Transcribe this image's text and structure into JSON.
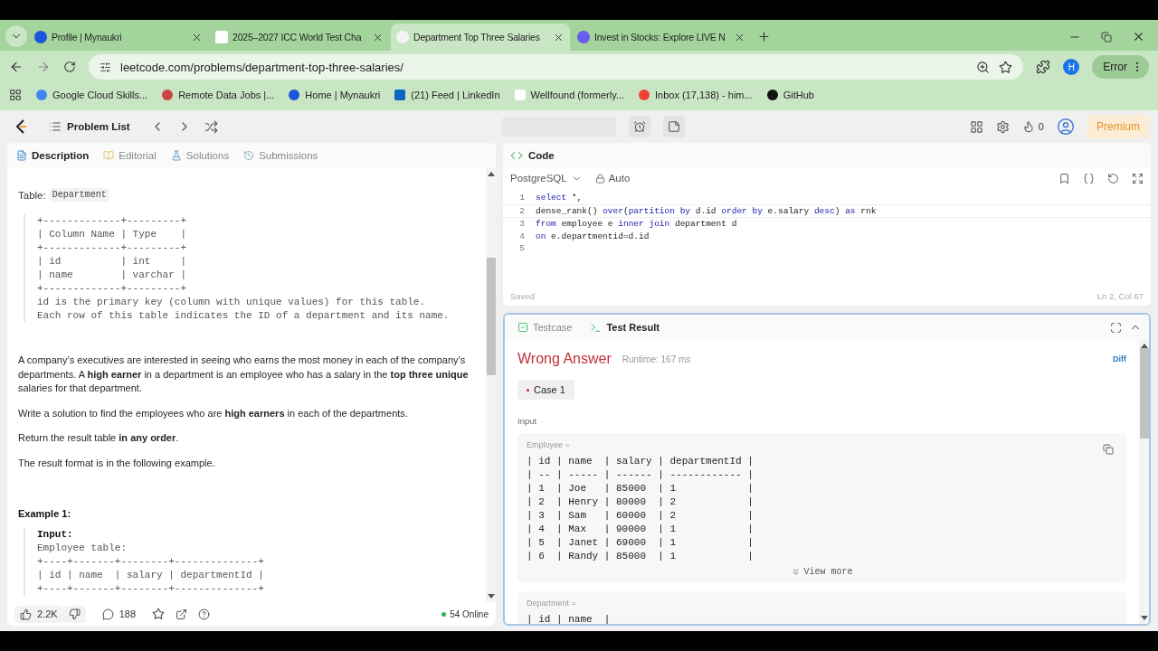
{
  "browser": {
    "tabs": [
      {
        "title": "Profile | Mynaukri",
        "selected": false
      },
      {
        "title": "2025–2027 ICC World Test Cha",
        "selected": false
      },
      {
        "title": "Department Top Three Salaries",
        "selected": true
      },
      {
        "title": "Invest in Stocks: Explore LIVE N",
        "selected": false
      }
    ],
    "address": "leetcode.com/problems/department-top-three-salaries/",
    "profile_initial": "H",
    "error_button": "Error",
    "bookmarks": [
      "Google Cloud Skills...",
      "Remote Data Jobs |...",
      "Home | Mynaukri",
      "(21) Feed | LinkedIn",
      "Wellfound (formerly...",
      "Inbox (17,138) - him...",
      "GitHub"
    ]
  },
  "topbar": {
    "problem_list": "Problem List",
    "streak": "0",
    "premium": "Premium"
  },
  "description": {
    "tabs": [
      {
        "label": "Description",
        "selected": true
      },
      {
        "label": "Editorial",
        "selected": false
      },
      {
        "label": "Solutions",
        "selected": false
      },
      {
        "label": "Submissions",
        "selected": false
      }
    ],
    "table_label": "Table:",
    "table_name": "Department",
    "schema": [
      "+-------------+---------+",
      "| Column Name | Type    |",
      "+-------------+---------+",
      "| id          | int     |",
      "| name        | varchar |",
      "+-------------+---------+",
      "id is the primary key (column with unique values) for this table.",
      "Each row of this table indicates the ID of a department and its name."
    ],
    "paragraphs": [
      "A company’s executives are interested in seeing who earns the most money in each of the company’s departments. A **high earner** in a department is an employee who has a salary in the **top three unique** salaries for that department.",
      "Write a solution to find the employees who are **high earners** in each of the departments.",
      "Return the result table **in any order**.",
      "The result format is in the following example."
    ],
    "example_title": "Example 1:",
    "example_input_label": "Input:",
    "example_lines": [
      "Employee table:",
      "+----+-------+--------+--------------+",
      "| id | name  | salary | departmentId |",
      "+----+-------+--------+--------------+"
    ],
    "likes": "2.2K",
    "comments": "188",
    "online": "54 Online"
  },
  "code": {
    "title": "Code",
    "language": "PostgreSQL",
    "mode": "Auto",
    "lines": [
      {
        "number": "1",
        "tokens": [
          {
            "kind": "keyword",
            "text": "select"
          },
          {
            "kind": "plain",
            "text": " *,"
          }
        ]
      },
      {
        "number": "2",
        "tokens": [
          {
            "kind": "plain",
            "text": "dense_rank() "
          },
          {
            "kind": "keyword",
            "text": "over"
          },
          {
            "kind": "plain",
            "text": "("
          },
          {
            "kind": "keyword",
            "text": "partition by"
          },
          {
            "kind": "plain",
            "text": " d.id "
          },
          {
            "kind": "keyword",
            "text": "order by"
          },
          {
            "kind": "plain",
            "text": " e.salary "
          },
          {
            "kind": "keyword",
            "text": "desc"
          },
          {
            "kind": "plain",
            "text": ") "
          },
          {
            "kind": "keyword",
            "text": "as"
          },
          {
            "kind": "plain",
            "text": " rnk"
          }
        ]
      },
      {
        "number": "3",
        "tokens": [
          {
            "kind": "keyword",
            "text": "from"
          },
          {
            "kind": "plain",
            "text": " employee e "
          },
          {
            "kind": "keyword",
            "text": "inner join"
          },
          {
            "kind": "plain",
            "text": " department d"
          }
        ]
      },
      {
        "number": "4",
        "tokens": [
          {
            "kind": "keyword",
            "text": "on"
          },
          {
            "kind": "plain",
            "text": " e.departmentid=d.id"
          }
        ]
      },
      {
        "number": "5"
      }
    ],
    "status": "Saved",
    "cursor": "Ln 2, Col 67"
  },
  "result": {
    "tabs": [
      {
        "label": "Testcase",
        "selected": false
      },
      {
        "label": "Test Result",
        "selected": true
      }
    ],
    "verdict": "Wrong Answer",
    "runtime": "Runtime: 167 ms",
    "diff": "Diff",
    "cases": [
      {
        "label": "Case 1",
        "selected": true
      }
    ],
    "input_label": "Input",
    "inputs": [
      {
        "name": "Employee =",
        "lines": [
          "| id | name  | salary | departmentId |",
          "| -- | ----- | ------ | ------------ |",
          "| 1  | Joe   | 85000  | 1            |",
          "| 2  | Henry | 80000  | 2            |",
          "| 3  | Sam   | 60000  | 2            |",
          "| 4  | Max   | 90000  | 1            |",
          "| 5  | Janet | 69000  | 1            |",
          "| 6  | Randy | 85000  | 1            |"
        ],
        "view_more": "View more"
      },
      {
        "name": "Department =",
        "lines": [
          "| id | name  |"
        ]
      }
    ]
  }
}
